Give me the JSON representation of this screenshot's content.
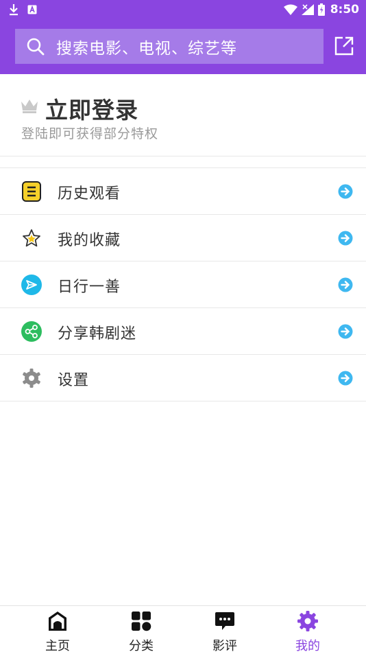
{
  "status_bar": {
    "time": "8:50",
    "left_icons": [
      "download-icon",
      "keyboard-a-icon"
    ],
    "right_icons": [
      "wifi-icon",
      "signal-icon",
      "battery-icon"
    ]
  },
  "search": {
    "placeholder": "搜索电影、电视、综艺等"
  },
  "profile": {
    "login_title": "立即登录",
    "login_subtitle": "登陆即可获得部分特权"
  },
  "menu": [
    {
      "label": "历史观看",
      "icon": "history-icon"
    },
    {
      "label": "我的收藏",
      "icon": "star-icon"
    },
    {
      "label": "日行一善",
      "icon": "paper-plane-icon"
    },
    {
      "label": "分享韩剧迷",
      "icon": "share-icon"
    },
    {
      "label": "设置",
      "icon": "gear-icon"
    }
  ],
  "bottom_nav": [
    {
      "label": "主页",
      "icon": "home-icon",
      "active": false
    },
    {
      "label": "分类",
      "icon": "category-icon",
      "active": false
    },
    {
      "label": "影评",
      "icon": "comment-icon",
      "active": false
    },
    {
      "label": "我的",
      "icon": "gear-icon",
      "active": true
    }
  ],
  "colors": {
    "brand": "#8a45e0",
    "search_bg": "#a57be8",
    "arrow": "#3fb8f0",
    "plane_bg": "#1fb8e8",
    "share_bg": "#2dbd5f",
    "history_bg": "#f5d02a"
  }
}
